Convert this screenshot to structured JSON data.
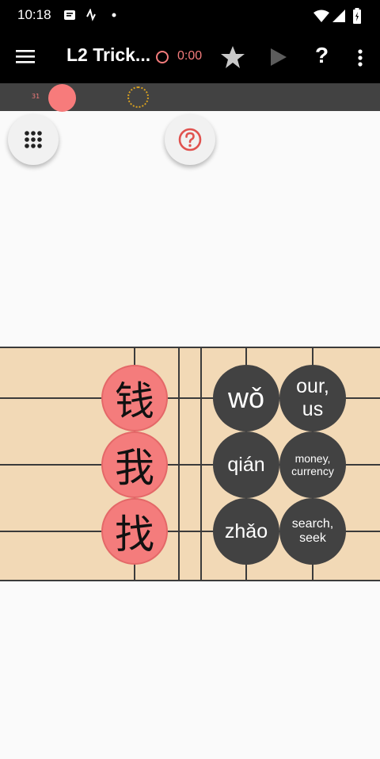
{
  "status_bar": {
    "time": "10:18",
    "icons": [
      "message-icon",
      "activity-icon",
      "dot-icon",
      "wifi-icon",
      "signal-icon",
      "battery-icon"
    ]
  },
  "app_bar": {
    "title": "L2 Trick...",
    "timer": "0:00",
    "icons": [
      "menu-icon",
      "timer-icon",
      "star-icon",
      "play-icon",
      "help-icon",
      "more-icon"
    ]
  },
  "progress": {
    "count": "31"
  },
  "colors": {
    "accent": "#f47c7c",
    "board": "#f2d9b6",
    "tile": "#424242",
    "bar": "#000000"
  },
  "board": {
    "characters": [
      "钱",
      "我",
      "找"
    ],
    "pinyin": [
      "wǒ",
      "qián",
      "zhǎo"
    ],
    "meanings": [
      "our, us",
      "money, currency",
      "search, seek"
    ]
  }
}
